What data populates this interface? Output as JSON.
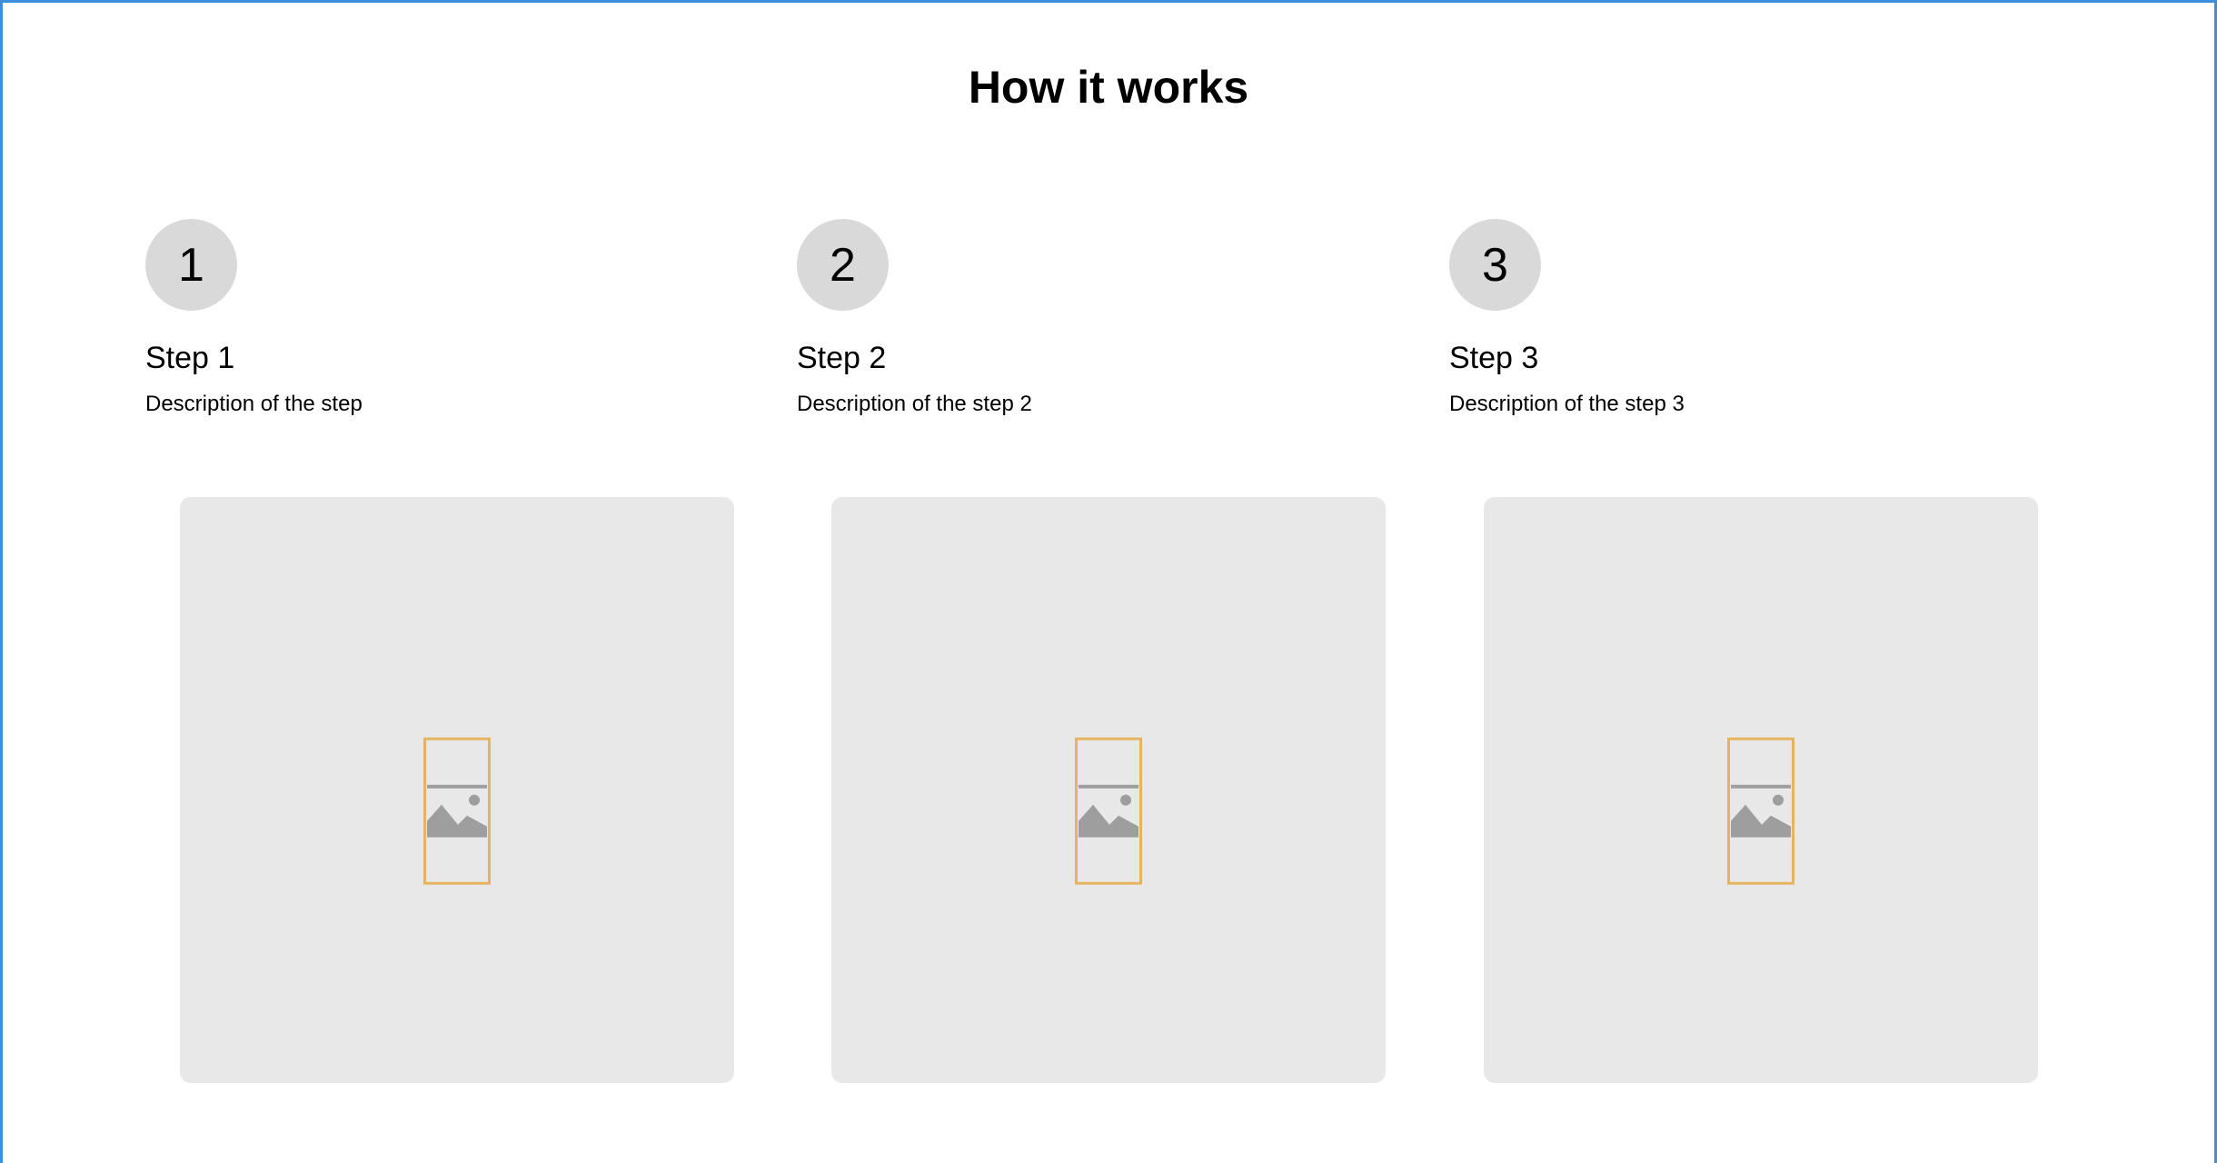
{
  "section": {
    "title": "How it works"
  },
  "steps": [
    {
      "number": "1",
      "title": "Step 1",
      "description": "Description of the step"
    },
    {
      "number": "2",
      "title": "Step 2",
      "description": "Description of the step 2"
    },
    {
      "number": "3",
      "title": "Step 3",
      "description": "Description of the step 3"
    }
  ],
  "images": [
    {
      "icon": "image-placeholder-icon"
    },
    {
      "icon": "image-placeholder-icon"
    },
    {
      "icon": "image-placeholder-icon"
    }
  ],
  "colors": {
    "frame_border": "#3d8fdc",
    "circle_bg": "#d9d9d9",
    "card_bg": "#e8e8e8",
    "placeholder_border": "#e6b460",
    "placeholder_icon": "#9e9e9e"
  }
}
